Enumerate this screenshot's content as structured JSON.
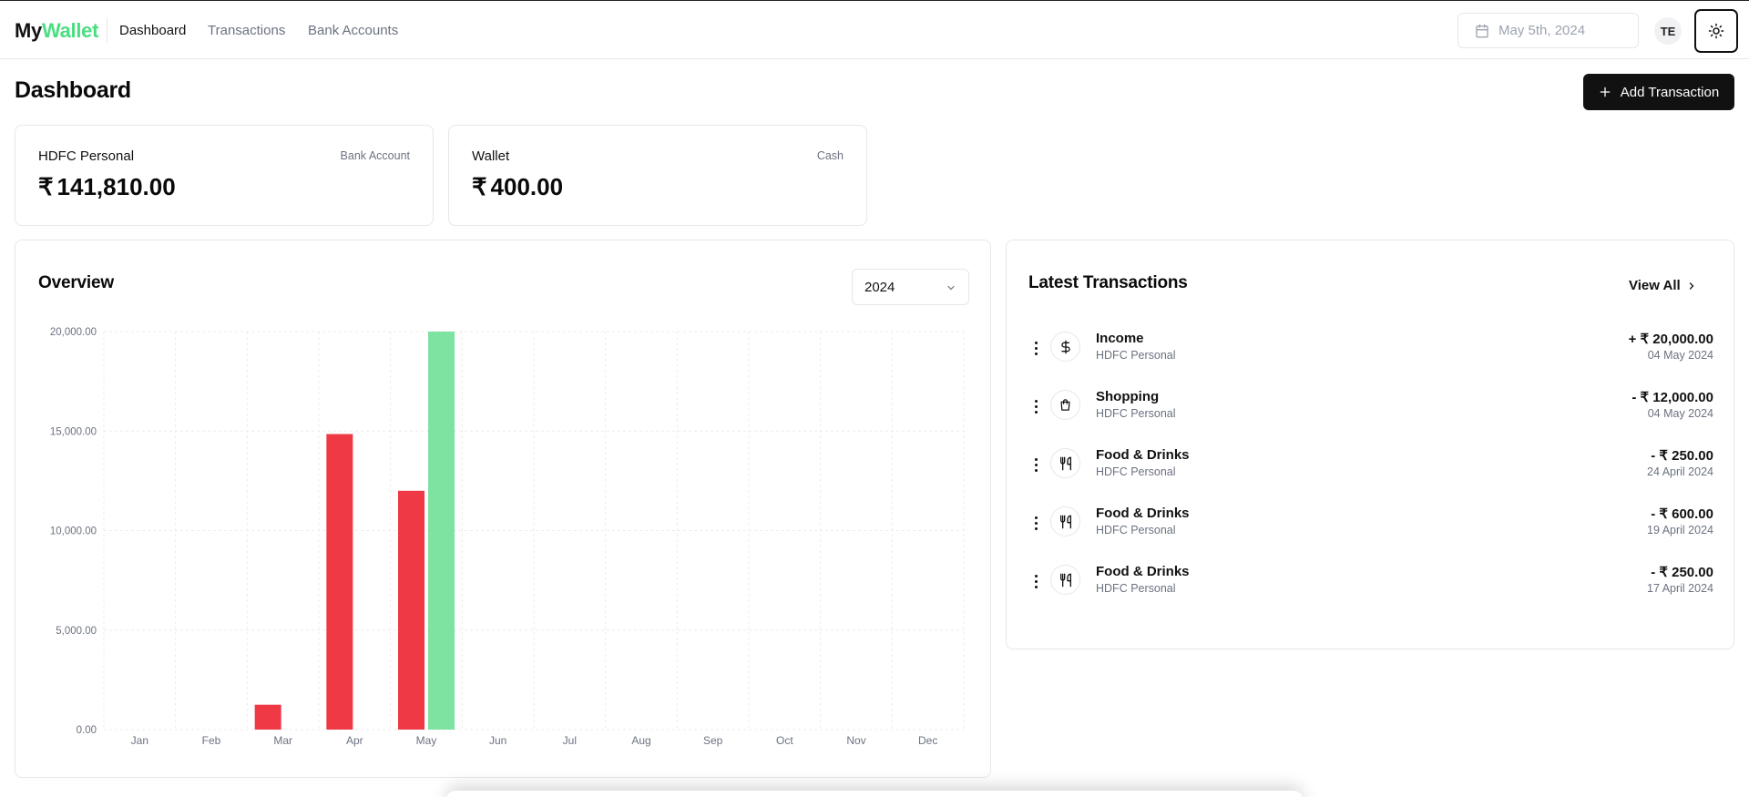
{
  "app": {
    "logo_my": "My",
    "logo_wallet": "Wallet"
  },
  "nav": [
    {
      "label": "Dashboard",
      "active": true
    },
    {
      "label": "Transactions",
      "active": false
    },
    {
      "label": "Bank Accounts",
      "active": false
    }
  ],
  "header": {
    "date": "May 5th, 2024",
    "avatar_initials": "TE"
  },
  "page": {
    "title": "Dashboard",
    "add_button": "Add Transaction"
  },
  "currency_symbol": "₹",
  "accounts": [
    {
      "name": "HDFC Personal",
      "type": "Bank Account",
      "balance": "141,810.00"
    },
    {
      "name": "Wallet",
      "type": "Cash",
      "balance": "400.00"
    }
  ],
  "overview": {
    "title": "Overview",
    "year": "2024"
  },
  "chart_data": {
    "type": "bar",
    "categories": [
      "Jan",
      "Feb",
      "Mar",
      "Apr",
      "May",
      "Jun",
      "Jul",
      "Aug",
      "Sep",
      "Oct",
      "Nov",
      "Dec"
    ],
    "series": [
      {
        "values": [
          0,
          0,
          1250,
          14850,
          12000,
          0,
          0,
          0,
          0,
          0,
          0,
          0
        ],
        "color": "#ef3a46"
      },
      {
        "values": [
          0,
          0,
          0,
          0,
          20000,
          0,
          0,
          0,
          0,
          0,
          0,
          0
        ],
        "color": "#7ee2a0"
      }
    ],
    "y_ticks": [
      "0.00",
      "5,000.00",
      "10,000.00",
      "15,000.00",
      "20,000.00"
    ],
    "ylim": [
      0,
      20000
    ],
    "grid": true
  },
  "latest": {
    "title": "Latest Transactions",
    "view_all": "View All",
    "items": [
      {
        "category": "Income",
        "account": "HDFC Personal",
        "amount": "+ ₹ 20,000.00",
        "date": "04 May 2024",
        "icon": "dollar-icon"
      },
      {
        "category": "Shopping",
        "account": "HDFC Personal",
        "amount": "- ₹ 12,000.00",
        "date": "04 May 2024",
        "icon": "shopping-bag-icon"
      },
      {
        "category": "Food & Drinks",
        "account": "HDFC Personal",
        "amount": "- ₹ 250.00",
        "date": "24 April 2024",
        "icon": "utensils-icon"
      },
      {
        "category": "Food & Drinks",
        "account": "HDFC Personal",
        "amount": "- ₹ 600.00",
        "date": "19 April 2024",
        "icon": "utensils-icon"
      },
      {
        "category": "Food & Drinks",
        "account": "HDFC Personal",
        "amount": "- ₹ 250.00",
        "date": "17 April 2024",
        "icon": "utensils-icon"
      }
    ]
  }
}
